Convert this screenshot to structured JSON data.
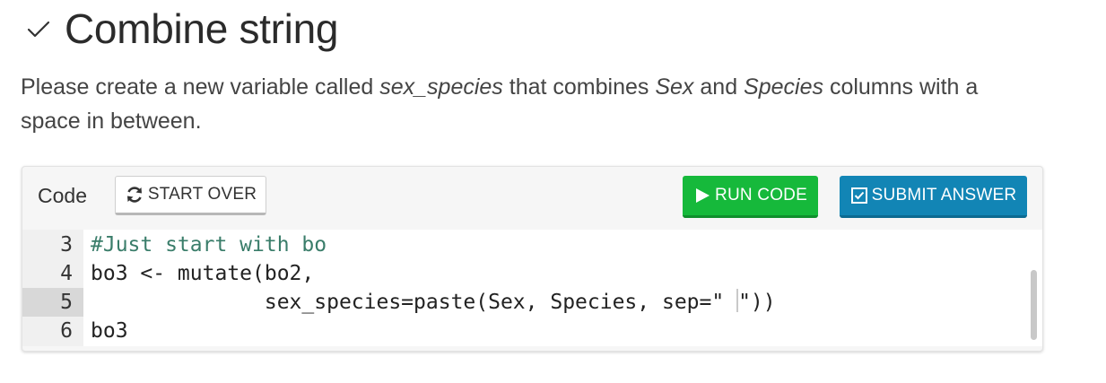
{
  "exercise": {
    "title": "Combine string",
    "description": {
      "part1": "Please create a new variable called ",
      "var_name": "sex_species",
      "part2": " that combines ",
      "col1": "Sex",
      "part3": " and ",
      "col2": "Species",
      "part4": " columns with a space in between."
    }
  },
  "panel": {
    "label": "Code",
    "start_over_label": "START OVER",
    "run_code_label": "RUN CODE",
    "submit_label": "SUBMIT ANSWER",
    "colors": {
      "run": "#16b93b",
      "submit": "#1285b5"
    }
  },
  "editor": {
    "lines": [
      {
        "num": "3",
        "code": "#Just start with bo"
      },
      {
        "num": "4",
        "code": "bo3 <- mutate(bo2,"
      },
      {
        "num": "5",
        "code_before": "              sex_species=paste(Sex, Species, sep=\" ",
        "code_after": "\"))"
      },
      {
        "num": "6",
        "code": "bo3"
      }
    ]
  },
  "icons": {
    "heading": "check-icon",
    "start_over": "refresh-icon",
    "run": "play-icon",
    "submit": "checkbox-icon"
  }
}
